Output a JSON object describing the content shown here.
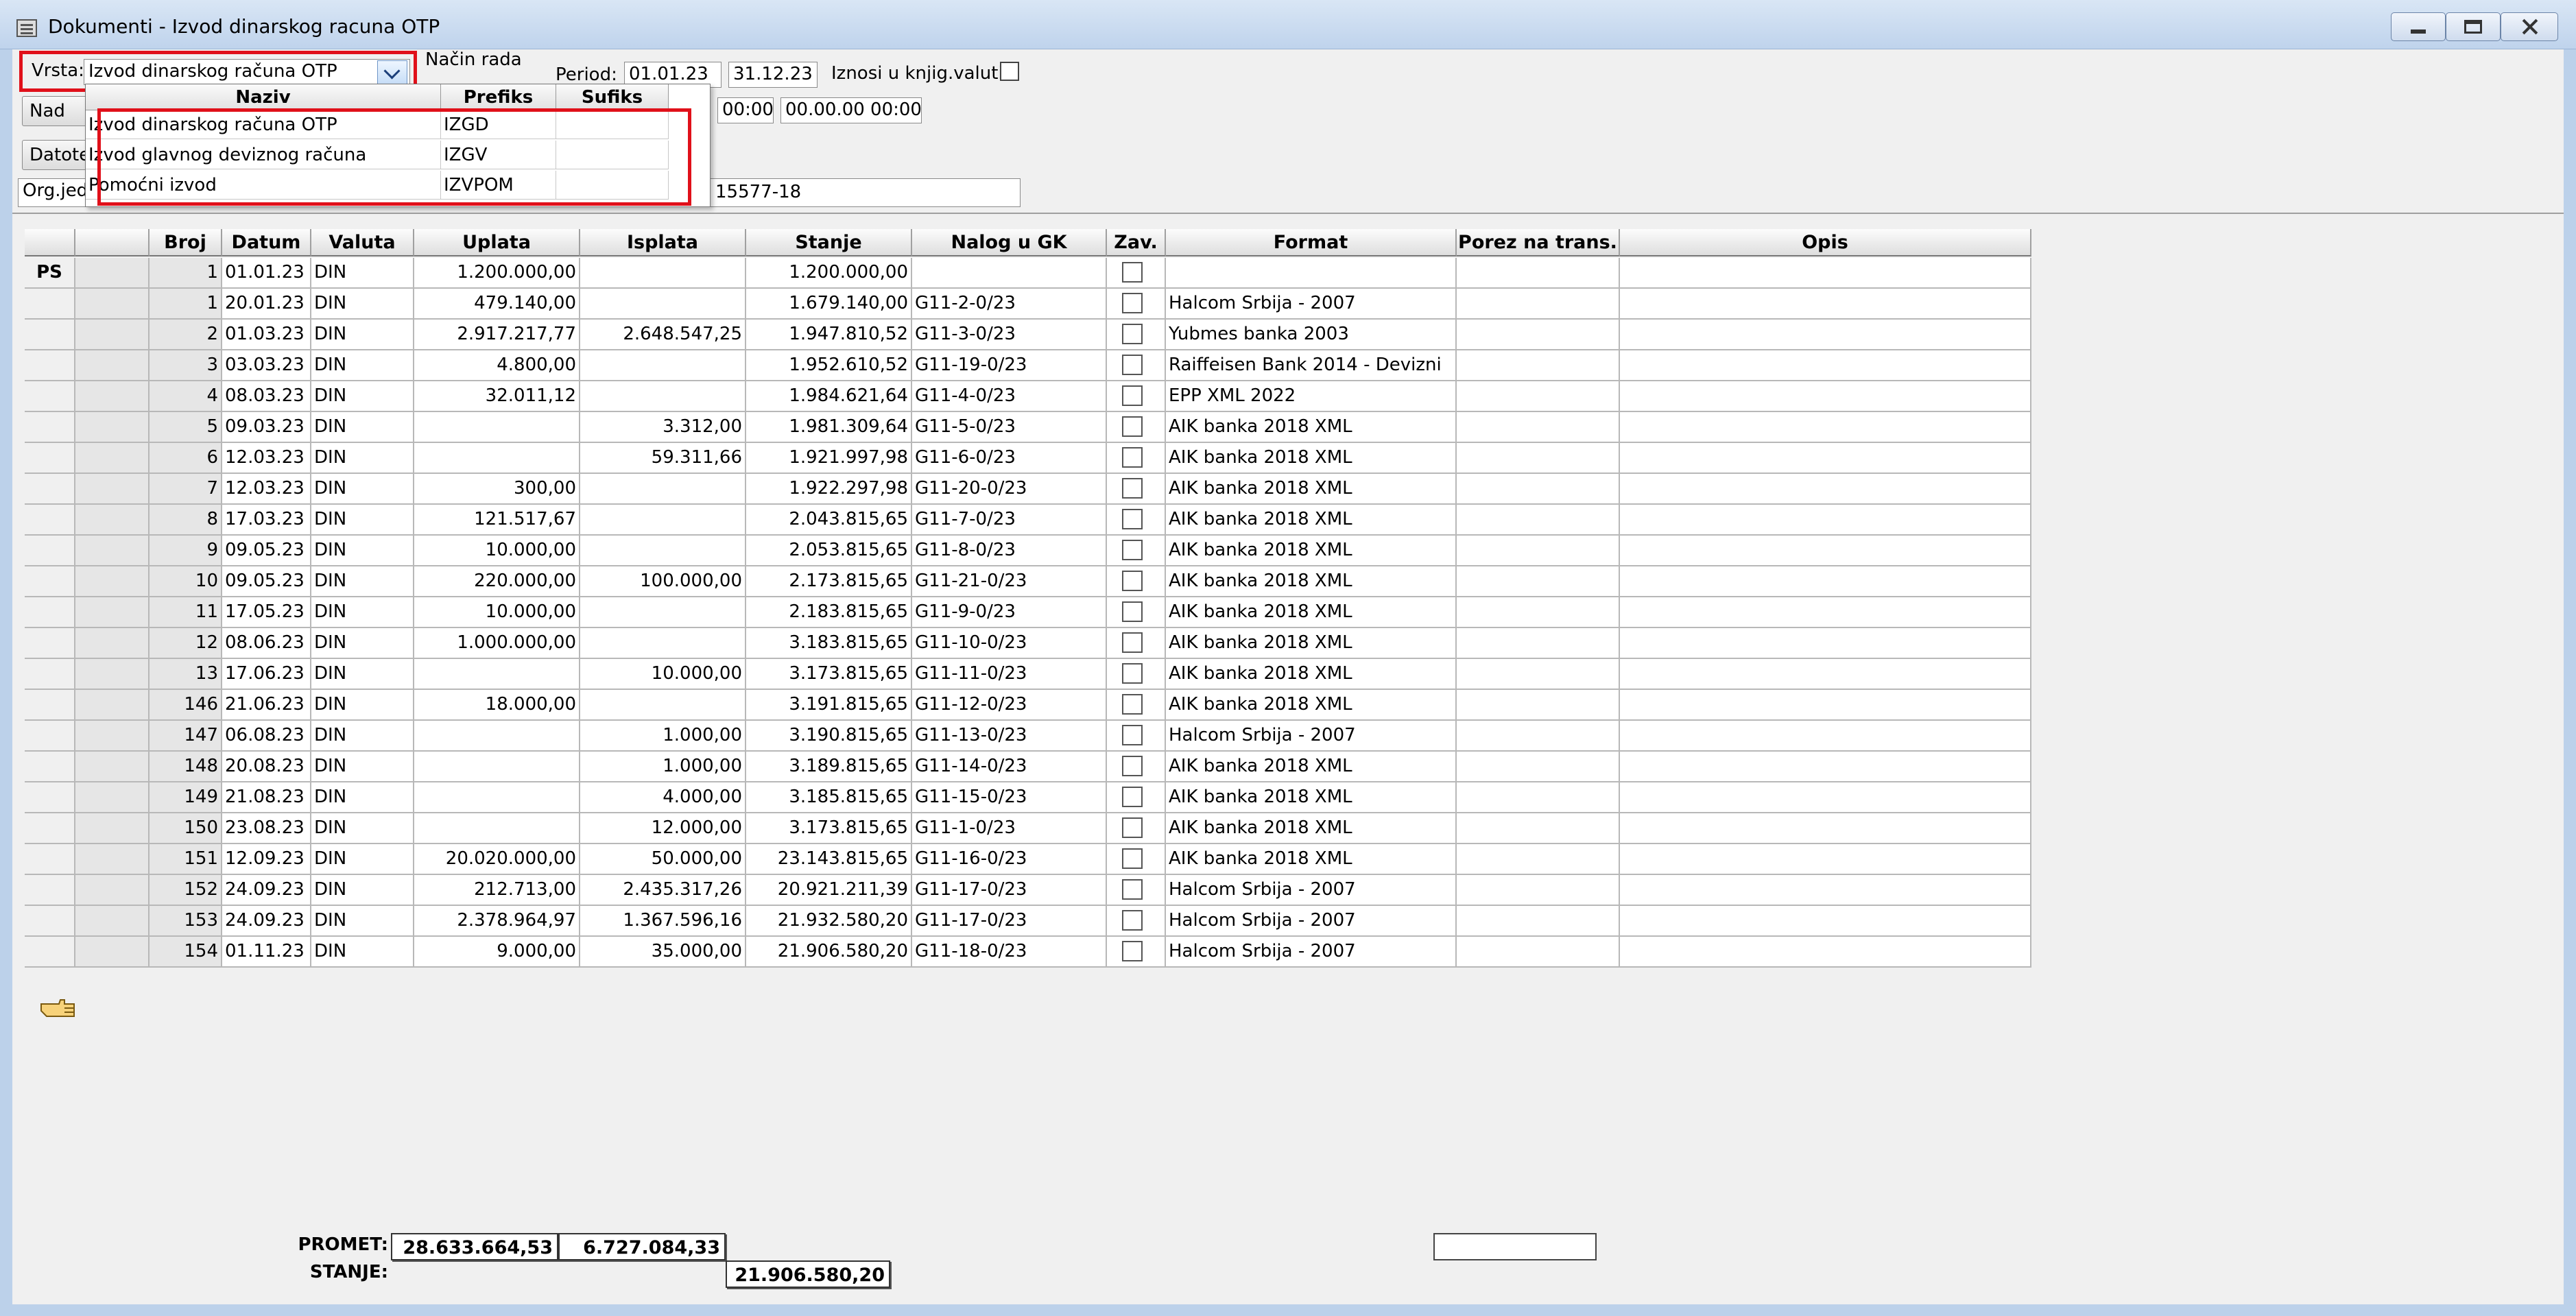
{
  "window": {
    "title": "Dokumenti - Izvod dinarskog racuna OTP"
  },
  "toolbar": {
    "vrsta_label": "Vrsta:",
    "vrsta_value": "Izvod dinarskog računa OTP",
    "nacin_rada_label": "Način rada",
    "period_label": "Period:",
    "period_from": "01.01.23",
    "period_to": "31.12.23",
    "iznosi_label": "Iznosi u knjig.valuti:",
    "time_from": "00:00",
    "time_to": "00.00.00 00:00",
    "btn_nad_label": "Nad",
    "btn_datot_label": "Datote",
    "orgjed_label": "Org.jed",
    "org_account_fragment": "15577-18"
  },
  "dropdown": {
    "headers": [
      "Naziv",
      "Prefiks",
      "Sufiks"
    ],
    "rows": [
      {
        "naziv": "Izvod dinarskog računa OTP",
        "prefiks": "IZGD",
        "sufiks": ""
      },
      {
        "naziv": "Izvod glavnog deviznog računa",
        "prefiks": "IZGV",
        "sufiks": ""
      },
      {
        "naziv": "Pomoćni izvod",
        "prefiks": "IZVPOM",
        "sufiks": ""
      }
    ]
  },
  "grid": {
    "headers": [
      "Broj",
      "Datum",
      "Valuta",
      "Uplata",
      "Isplata",
      "Stanje",
      "Nalog u GK",
      "Zav.",
      "Format",
      "Porez na trans.",
      "Opis"
    ],
    "rows": [
      {
        "ind": "PS",
        "broj": "1",
        "datum": "01.01.23",
        "valuta": "DIN",
        "uplata": "1.200.000,00",
        "isplata": "",
        "stanje": "1.200.000,00",
        "nalog": "",
        "format": "",
        "porez": "",
        "opis": ""
      },
      {
        "ind": "",
        "broj": "1",
        "datum": "20.01.23",
        "valuta": "DIN",
        "uplata": "479.140,00",
        "isplata": "",
        "stanje": "1.679.140,00",
        "nalog": "G11-2-0/23",
        "format": "Halcom Srbija - 2007",
        "porez": "",
        "opis": ""
      },
      {
        "ind": "",
        "broj": "2",
        "datum": "01.03.23",
        "valuta": "DIN",
        "uplata": "2.917.217,77",
        "isplata": "2.648.547,25",
        "stanje": "1.947.810,52",
        "nalog": "G11-3-0/23",
        "format": "Yubmes banka 2003",
        "porez": "",
        "opis": ""
      },
      {
        "ind": "",
        "broj": "3",
        "datum": "03.03.23",
        "valuta": "DIN",
        "uplata": "4.800,00",
        "isplata": "",
        "stanje": "1.952.610,52",
        "nalog": "G11-19-0/23",
        "format": "Raiffeisen Bank 2014 - Devizni",
        "porez": "",
        "opis": ""
      },
      {
        "ind": "",
        "broj": "4",
        "datum": "08.03.23",
        "valuta": "DIN",
        "uplata": "32.011,12",
        "isplata": "",
        "stanje": "1.984.621,64",
        "nalog": "G11-4-0/23",
        "format": "EPP XML 2022",
        "porez": "",
        "opis": ""
      },
      {
        "ind": "",
        "broj": "5",
        "datum": "09.03.23",
        "valuta": "DIN",
        "uplata": "",
        "isplata": "3.312,00",
        "stanje": "1.981.309,64",
        "nalog": "G11-5-0/23",
        "format": "AIK banka 2018 XML",
        "porez": "",
        "opis": ""
      },
      {
        "ind": "",
        "broj": "6",
        "datum": "12.03.23",
        "valuta": "DIN",
        "uplata": "",
        "isplata": "59.311,66",
        "stanje": "1.921.997,98",
        "nalog": "G11-6-0/23",
        "format": "AIK banka 2018 XML",
        "porez": "",
        "opis": ""
      },
      {
        "ind": "",
        "broj": "7",
        "datum": "12.03.23",
        "valuta": "DIN",
        "uplata": "300,00",
        "isplata": "",
        "stanje": "1.922.297,98",
        "nalog": "G11-20-0/23",
        "format": "AIK banka 2018 XML",
        "porez": "",
        "opis": ""
      },
      {
        "ind": "",
        "broj": "8",
        "datum": "17.03.23",
        "valuta": "DIN",
        "uplata": "121.517,67",
        "isplata": "",
        "stanje": "2.043.815,65",
        "nalog": "G11-7-0/23",
        "format": "AIK banka 2018 XML",
        "porez": "",
        "opis": ""
      },
      {
        "ind": "",
        "broj": "9",
        "datum": "09.05.23",
        "valuta": "DIN",
        "uplata": "10.000,00",
        "isplata": "",
        "stanje": "2.053.815,65",
        "nalog": "G11-8-0/23",
        "format": "AIK banka 2018 XML",
        "porez": "",
        "opis": ""
      },
      {
        "ind": "",
        "broj": "10",
        "datum": "09.05.23",
        "valuta": "DIN",
        "uplata": "220.000,00",
        "isplata": "100.000,00",
        "stanje": "2.173.815,65",
        "nalog": "G11-21-0/23",
        "format": "AIK banka 2018 XML",
        "porez": "",
        "opis": ""
      },
      {
        "ind": "",
        "broj": "11",
        "datum": "17.05.23",
        "valuta": "DIN",
        "uplata": "10.000,00",
        "isplata": "",
        "stanje": "2.183.815,65",
        "nalog": "G11-9-0/23",
        "format": "AIK banka 2018 XML",
        "porez": "",
        "opis": ""
      },
      {
        "ind": "",
        "broj": "12",
        "datum": "08.06.23",
        "valuta": "DIN",
        "uplata": "1.000.000,00",
        "isplata": "",
        "stanje": "3.183.815,65",
        "nalog": "G11-10-0/23",
        "format": "AIK banka 2018 XML",
        "porez": "",
        "opis": ""
      },
      {
        "ind": "",
        "broj": "13",
        "datum": "17.06.23",
        "valuta": "DIN",
        "uplata": "",
        "isplata": "10.000,00",
        "stanje": "3.173.815,65",
        "nalog": "G11-11-0/23",
        "format": "AIK banka 2018 XML",
        "porez": "",
        "opis": ""
      },
      {
        "ind": "",
        "broj": "146",
        "datum": "21.06.23",
        "valuta": "DIN",
        "uplata": "18.000,00",
        "isplata": "",
        "stanje": "3.191.815,65",
        "nalog": "G11-12-0/23",
        "format": "AIK banka 2018 XML",
        "porez": "",
        "opis": ""
      },
      {
        "ind": "",
        "broj": "147",
        "datum": "06.08.23",
        "valuta": "DIN",
        "uplata": "",
        "isplata": "1.000,00",
        "stanje": "3.190.815,65",
        "nalog": "G11-13-0/23",
        "format": "Halcom Srbija - 2007",
        "porez": "",
        "opis": ""
      },
      {
        "ind": "",
        "broj": "148",
        "datum": "20.08.23",
        "valuta": "DIN",
        "uplata": "",
        "isplata": "1.000,00",
        "stanje": "3.189.815,65",
        "nalog": "G11-14-0/23",
        "format": "AIK banka 2018 XML",
        "porez": "",
        "opis": ""
      },
      {
        "ind": "",
        "broj": "149",
        "datum": "21.08.23",
        "valuta": "DIN",
        "uplata": "",
        "isplata": "4.000,00",
        "stanje": "3.185.815,65",
        "nalog": "G11-15-0/23",
        "format": "AIK banka 2018 XML",
        "porez": "",
        "opis": ""
      },
      {
        "ind": "",
        "broj": "150",
        "datum": "23.08.23",
        "valuta": "DIN",
        "uplata": "",
        "isplata": "12.000,00",
        "stanje": "3.173.815,65",
        "nalog": "G11-1-0/23",
        "format": "AIK banka 2018 XML",
        "porez": "",
        "opis": ""
      },
      {
        "ind": "",
        "broj": "151",
        "datum": "12.09.23",
        "valuta": "DIN",
        "uplata": "20.020.000,00",
        "isplata": "50.000,00",
        "stanje": "23.143.815,65",
        "nalog": "G11-16-0/23",
        "format": "AIK banka 2018 XML",
        "porez": "",
        "opis": ""
      },
      {
        "ind": "",
        "broj": "152",
        "datum": "24.09.23",
        "valuta": "DIN",
        "uplata": "212.713,00",
        "isplata": "2.435.317,26",
        "stanje": "20.921.211,39",
        "nalog": "G11-17-0/23",
        "format": "Halcom Srbija - 2007",
        "porez": "",
        "opis": ""
      },
      {
        "ind": "",
        "broj": "153",
        "datum": "24.09.23",
        "valuta": "DIN",
        "uplata": "2.378.964,97",
        "isplata": "1.367.596,16",
        "stanje": "21.932.580,20",
        "nalog": "G11-17-0/23",
        "format": "Halcom Srbija - 2007",
        "porez": "",
        "opis": ""
      },
      {
        "ind": "",
        "broj": "154",
        "datum": "01.11.23",
        "valuta": "DIN",
        "uplata": "9.000,00",
        "isplata": "35.000,00",
        "stanje": "21.906.580,20",
        "nalog": "G11-18-0/23",
        "format": "Halcom Srbija - 2007",
        "porez": "",
        "opis": ""
      }
    ]
  },
  "totals": {
    "promet_label": "PROMET:",
    "promet_uplata": "28.633.664,53",
    "promet_isplata": "6.727.084,33",
    "stanje_label": "STANJE:",
    "stanje_value": "21.906.580,20",
    "porez_total": ""
  },
  "icons": {
    "current_row_pointer": "hand-pointer-icon",
    "window_icon": "document-window-icon"
  }
}
